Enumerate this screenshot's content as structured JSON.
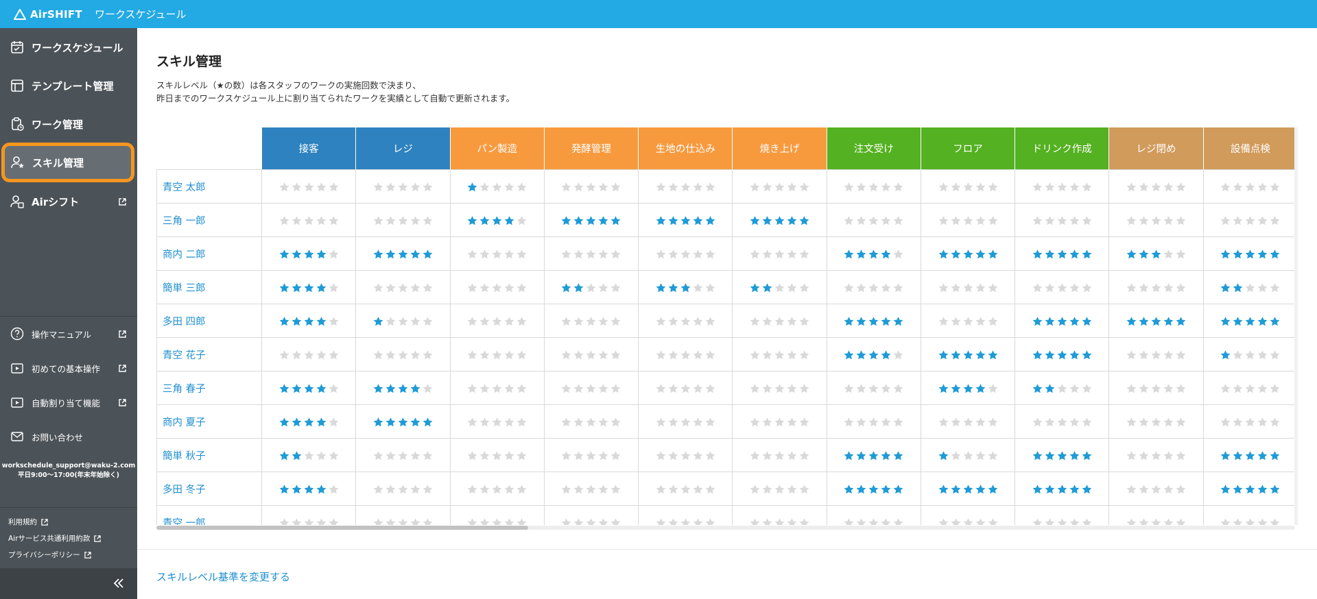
{
  "header": {
    "brand": "AirSHIFT",
    "app_name": "ワークスケジュール",
    "color": "#23aae4"
  },
  "sidebar": {
    "nav": [
      {
        "label": "ワークスケジュール",
        "icon": "calendar-icon"
      },
      {
        "label": "テンプレート管理",
        "icon": "template-icon"
      },
      {
        "label": "ワーク管理",
        "icon": "work-clipboard-icon"
      },
      {
        "label": "スキル管理",
        "icon": "user-star-icon",
        "active": true
      },
      {
        "label": "Airシフト",
        "icon": "user-shift-icon",
        "external": true
      }
    ],
    "help": [
      {
        "label": "操作マニュアル",
        "icon": "question-icon"
      },
      {
        "label": "初めての基本操作",
        "icon": "video-icon"
      },
      {
        "label": "自動割り当て機能",
        "icon": "video-icon"
      },
      {
        "label": "お問い合わせ",
        "icon": "mail-icon"
      }
    ],
    "contact_email": "workschedule_support@waku-2.com",
    "contact_hours": "平日9:00〜17:00(年末年始除く)",
    "legal": [
      "利用規約",
      "Airサービス共通利用約款",
      "プライバシーポリシー"
    ],
    "collapse_icon": "double-chevron-left-icon"
  },
  "main": {
    "title": "スキル管理",
    "desc_line1": "スキルレベル（★の数）は各スタッフのワークの実施回数で決まり、",
    "desc_line2": "昨日までのワークスケジュール上に割り当てられたワークを実績として自動で更新されます。",
    "footer_link": "スキルレベル基準を変更する"
  },
  "colors": {
    "blue": "#2e82bf",
    "orange": "#f79a3e",
    "green": "#54b121",
    "tan": "#d19b5b",
    "star_on": "#1f9bd7",
    "star_off": "#d9d9d9",
    "active_outline": "#f5961f"
  },
  "skill_table": {
    "skills": [
      {
        "name": "接客",
        "group": "blue"
      },
      {
        "name": "レジ",
        "group": "blue"
      },
      {
        "name": "パン製造",
        "group": "orange"
      },
      {
        "name": "発酵管理",
        "group": "orange"
      },
      {
        "name": "生地の仕込み",
        "group": "orange"
      },
      {
        "name": "焼き上げ",
        "group": "orange"
      },
      {
        "name": "注文受け",
        "group": "green"
      },
      {
        "name": "フロア",
        "group": "green"
      },
      {
        "name": "ドリンク作成",
        "group": "green"
      },
      {
        "name": "レジ閉め",
        "group": "tan"
      },
      {
        "name": "設備点検",
        "group": "tan"
      }
    ],
    "max_stars": 5,
    "staff": [
      {
        "name": "青空 太郎",
        "levels": [
          0,
          0,
          1,
          0,
          0,
          0,
          0,
          0,
          0,
          0,
          0
        ]
      },
      {
        "name": "三角 一郎",
        "levels": [
          0,
          0,
          4,
          5,
          5,
          5,
          0,
          0,
          0,
          0,
          0
        ]
      },
      {
        "name": "商内 二郎",
        "levels": [
          4,
          5,
          0,
          0,
          0,
          0,
          4,
          5,
          5,
          3,
          5
        ]
      },
      {
        "name": "簡単 三郎",
        "levels": [
          4,
          0,
          0,
          2,
          3,
          2,
          0,
          0,
          0,
          0,
          2
        ]
      },
      {
        "name": "多田 四郎",
        "levels": [
          4,
          1,
          0,
          0,
          0,
          0,
          5,
          0,
          5,
          5,
          5
        ]
      },
      {
        "name": "青空 花子",
        "levels": [
          0,
          0,
          0,
          0,
          0,
          0,
          4,
          5,
          5,
          0,
          1
        ]
      },
      {
        "name": "三角 春子",
        "levels": [
          4,
          4,
          0,
          0,
          0,
          0,
          0,
          4,
          2,
          0,
          0
        ]
      },
      {
        "name": "商内 夏子",
        "levels": [
          4,
          5,
          0,
          0,
          0,
          0,
          0,
          0,
          0,
          0,
          0
        ]
      },
      {
        "name": "簡単 秋子",
        "levels": [
          2,
          0,
          0,
          0,
          0,
          0,
          5,
          1,
          5,
          0,
          5
        ]
      },
      {
        "name": "多田 冬子",
        "levels": [
          4,
          0,
          0,
          0,
          0,
          0,
          5,
          5,
          5,
          0,
          5
        ]
      },
      {
        "name": "青空 一郎",
        "levels": [
          0,
          0,
          0,
          0,
          0,
          0,
          0,
          0,
          0,
          0,
          0
        ]
      }
    ]
  }
}
